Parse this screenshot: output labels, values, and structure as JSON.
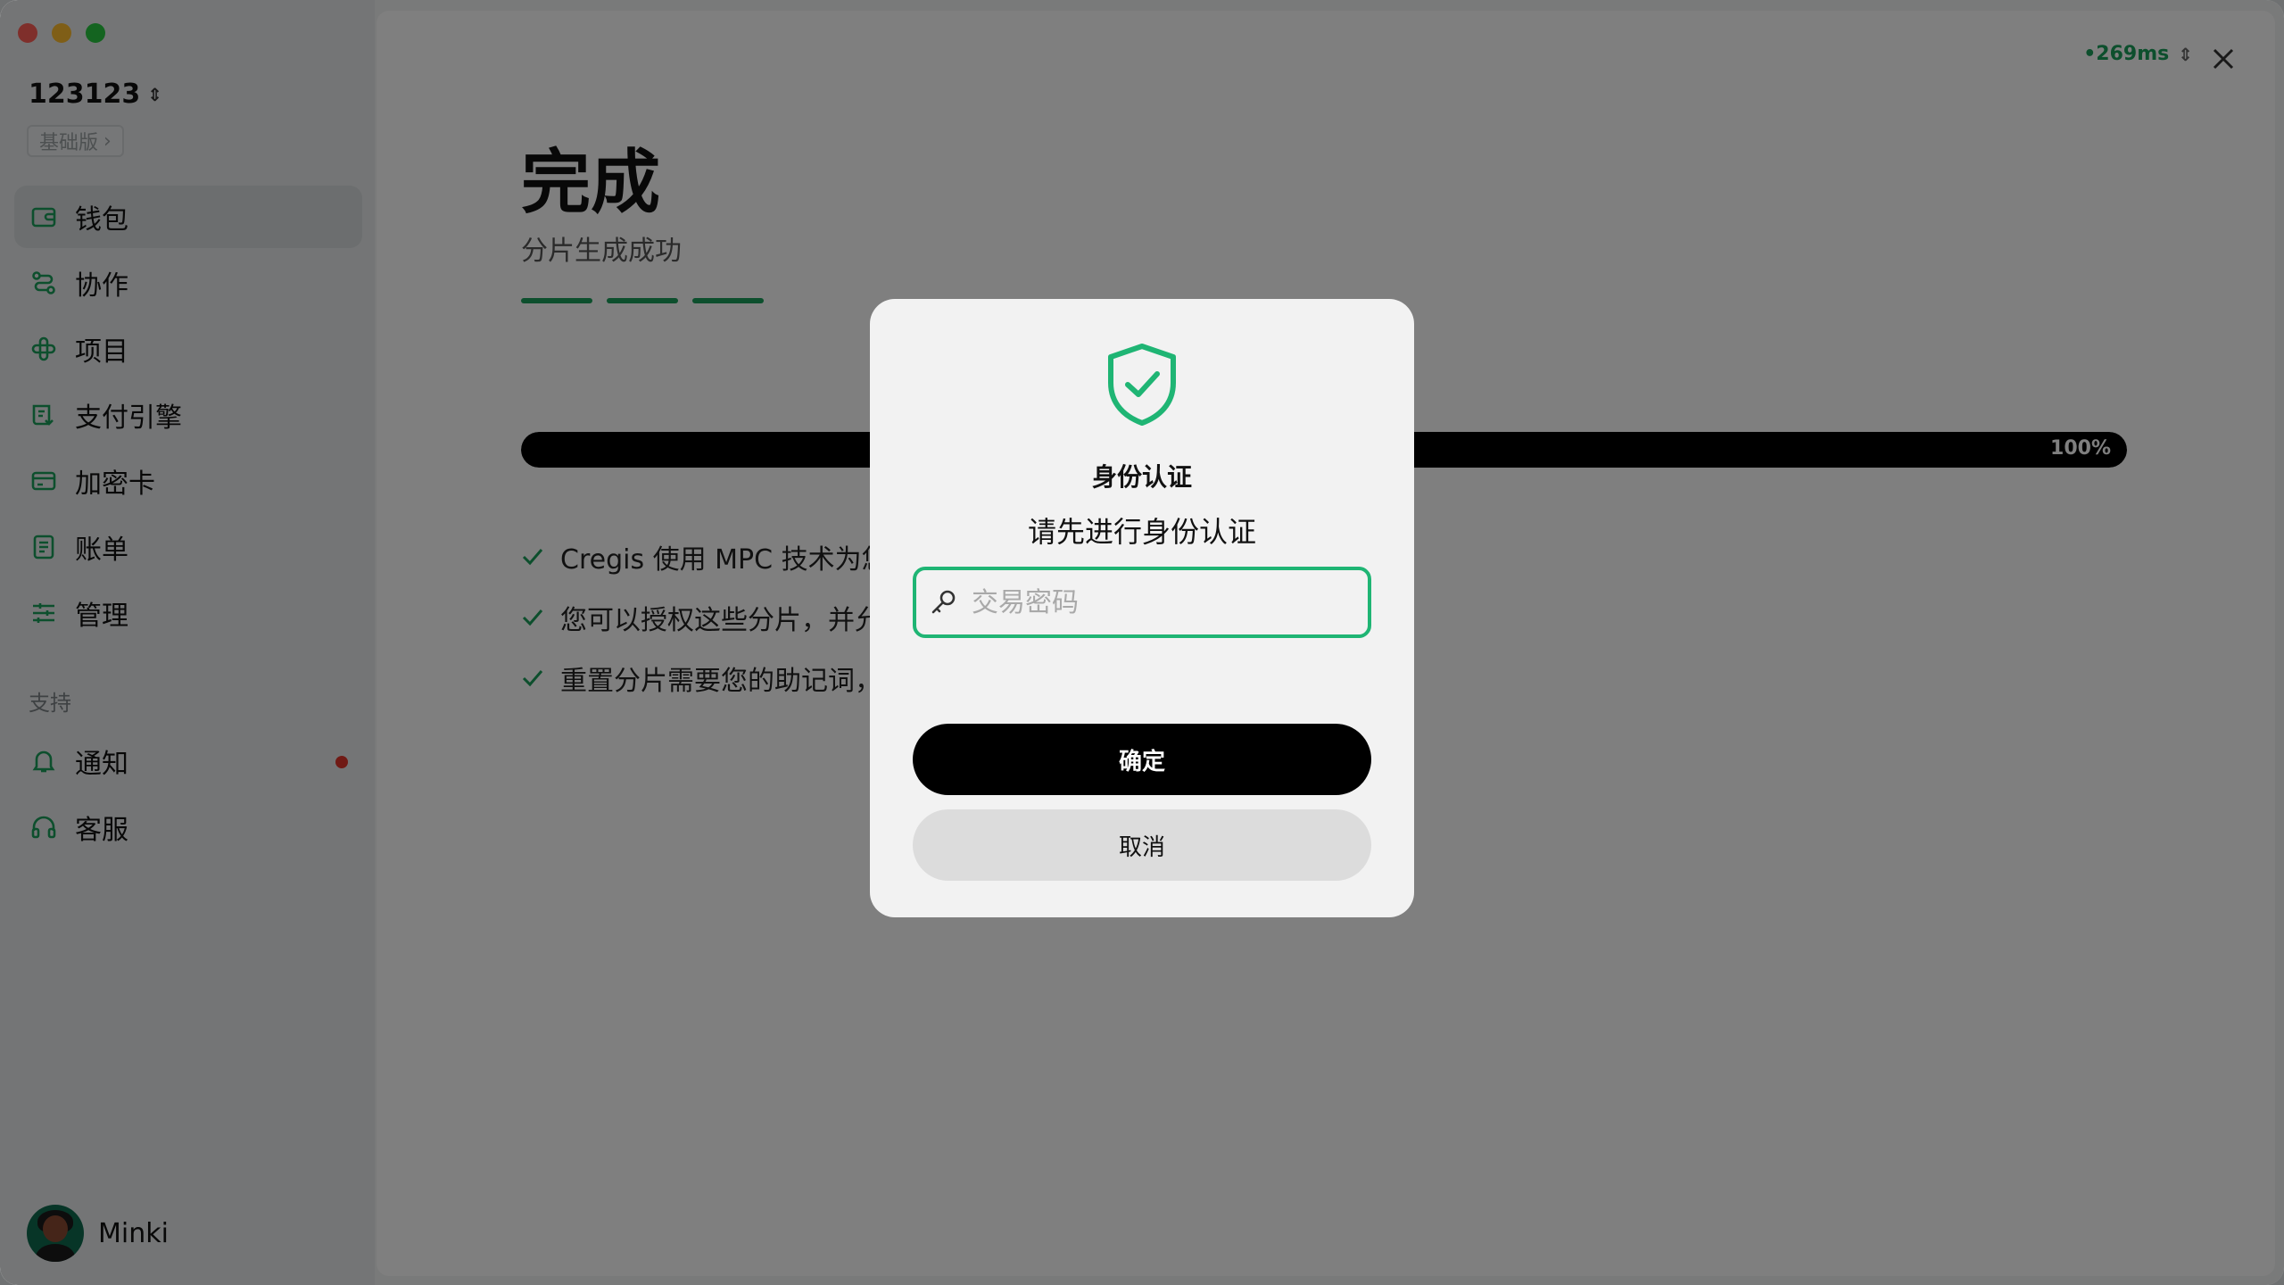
{
  "sidebar": {
    "org_name": "123123",
    "plan_badge": "基础版",
    "items": [
      {
        "label": "钱包",
        "icon": "wallet-icon",
        "active": true
      },
      {
        "label": "协作",
        "icon": "collaborate-icon"
      },
      {
        "label": "项目",
        "icon": "project-icon"
      },
      {
        "label": "支付引擎",
        "icon": "payment-engine-icon"
      },
      {
        "label": "加密卡",
        "icon": "card-icon"
      },
      {
        "label": "账单",
        "icon": "bill-icon"
      },
      {
        "label": "管理",
        "icon": "settings-sliders-icon"
      }
    ],
    "support_label": "支持",
    "support_items": [
      {
        "label": "通知",
        "icon": "bell-icon",
        "badge": "red-dot"
      },
      {
        "label": "客服",
        "icon": "headset-icon"
      }
    ],
    "user_name": "Minki"
  },
  "header": {
    "latency": "•269ms"
  },
  "main": {
    "title": "完成",
    "subtitle": "分片生成成功",
    "progress_label": "100%",
    "progress": 1.0,
    "checks": [
      "Cregis 使用 MPC 技术为您",
      "您可以授权这些分片，并允",
      "重置分片需要您的助记词，"
    ]
  },
  "modal": {
    "icon": "shield-check-icon",
    "title": "身份认证",
    "message": "请先进行身份认证",
    "password_placeholder": "交易密码",
    "password_value": "",
    "confirm_label": "确定",
    "cancel_label": "取消"
  },
  "colors": {
    "accent": "#1fb574",
    "badge_red": "#e0352b"
  }
}
